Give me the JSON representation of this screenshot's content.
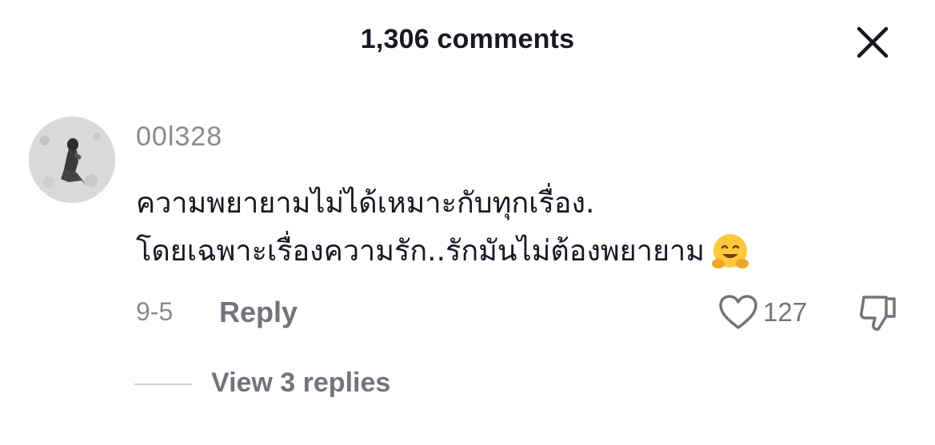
{
  "header": {
    "title": "1,306 comments",
    "close_icon": "close-icon"
  },
  "comment": {
    "avatar_icon": "avatar",
    "username": "00l328",
    "text_lines": [
      "ความพยายามไม่ได้เหมาะกับทุกเรื่อง.",
      "โดยเฉพาะเรื่องความรัก..รักมันไม่ต้องพยายาม"
    ],
    "emoji": "hugging-face-emoji",
    "date": "9-5",
    "reply_label": "Reply",
    "like_icon": "heart-icon",
    "like_count": "127",
    "dislike_icon": "thumbs-down-icon",
    "view_replies_label": "View 3 replies"
  }
}
